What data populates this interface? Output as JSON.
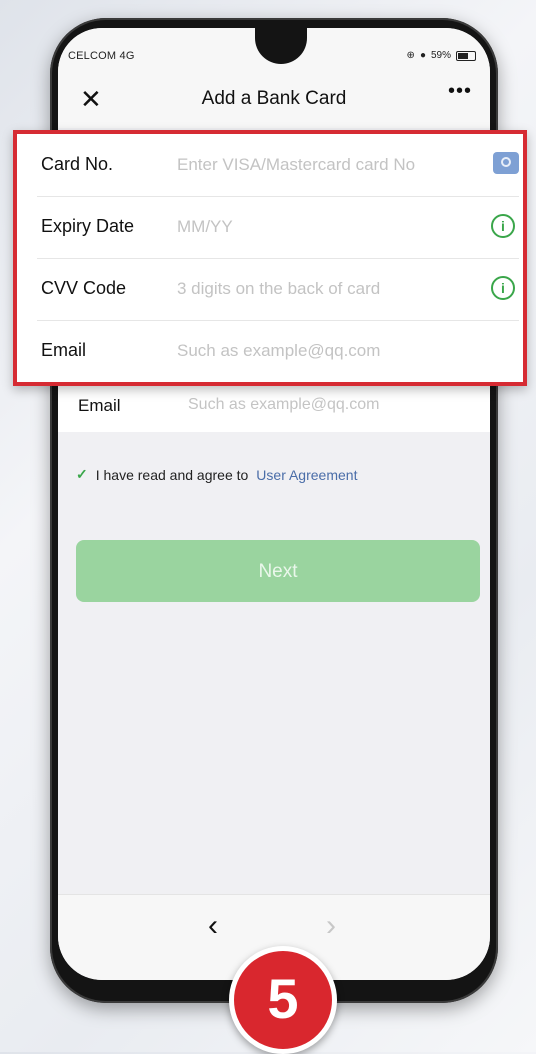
{
  "status_bar": {
    "carrier": "CELCOM 4G",
    "battery": "59%"
  },
  "header": {
    "close_icon_glyph": "✕",
    "title": "Add a Bank Card",
    "more_glyph": "•••"
  },
  "form": {
    "rows": [
      {
        "label": "Card No.",
        "placeholder": "Enter VISA/Mastercard card No",
        "icon": "camera-icon"
      },
      {
        "label": "Expiry Date",
        "placeholder": "MM/YY",
        "icon": "info-icon"
      },
      {
        "label": "CVV Code",
        "placeholder": "3 digits on the back of card",
        "icon": "info-icon"
      },
      {
        "label": "Email",
        "placeholder": "Such as example@qq.com",
        "icon": ""
      }
    ],
    "under_email_label": "Email",
    "under_email_placeholder": "Such as example@qq.com"
  },
  "agreement": {
    "check_glyph": "✓",
    "text": "I have read and agree to",
    "link": "User Agreement"
  },
  "next_button": "Next",
  "navigation": {
    "back_glyph": "‹",
    "forward_glyph": "›"
  },
  "step_badge": "5",
  "colors": {
    "highlight_border": "#d62b33",
    "next_button": "#9ad49f",
    "info_green": "#3aa64a",
    "link_blue": "#4a6da8"
  }
}
